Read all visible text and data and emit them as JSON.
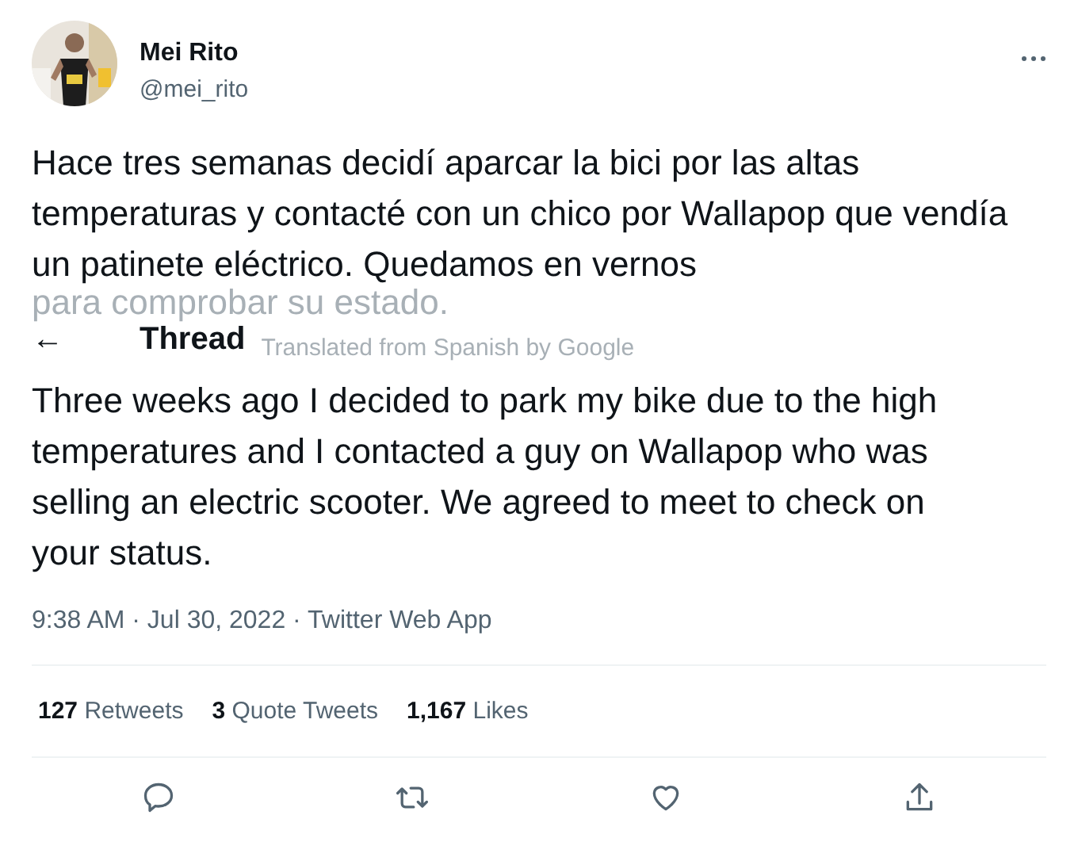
{
  "author": {
    "name": "Mei Rito",
    "handle": "@mei_rito"
  },
  "original_text": [
    "Hace tres semanas decidí aparcar la bici por las altas temperaturas y contacté con un chico por Wallapop que vendía un patinete eléctrico. Quedamos en vernos",
    "para comprobar su estado."
  ],
  "header": {
    "back": "←",
    "title": "Thread"
  },
  "translation_note": "Translated from Spanish by Google",
  "translated_text": "Three weeks ago I decided to park my bike due to the high temperatures and I contacted a guy on Wallapop who was selling an electric scooter. We agreed to meet to check on your status.",
  "meta": "9:38 AM · Jul 30, 2022 · Twitter Web App",
  "stats": [
    {
      "count": "127",
      "label": "Retweets"
    },
    {
      "count": "3",
      "label": "Quote Tweets"
    },
    {
      "count": "1,167",
      "label": "Likes"
    }
  ],
  "actions": [
    {
      "kind": "reply"
    },
    {
      "kind": "retweet"
    },
    {
      "kind": "like"
    },
    {
      "kind": "share"
    }
  ]
}
